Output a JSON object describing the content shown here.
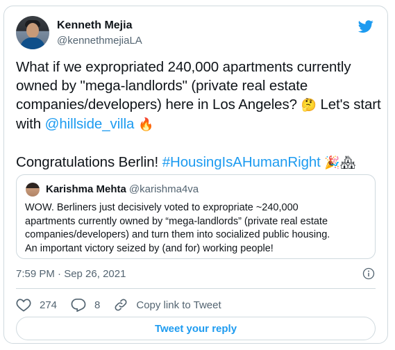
{
  "tweet": {
    "author_name": "Kenneth Mejia",
    "author_handle": "@kennethmejiaLA",
    "text": {
      "line1": "What if we expropriated 240,000 apartments currently",
      "line2": "owned by \"mega-landlords\" (private real estate",
      "line3_pre": "companies/developers) here in Los Angeles?",
      "line3_post": " Let's start",
      "line4_pre": "with ",
      "mention": "@hillside_villa",
      "line5_pre": "Congratulations Berlin! ",
      "hashtag": "#HousingIsAHumanRight"
    },
    "emojis": {
      "thinking": "🤔",
      "fire": "🔥",
      "party": "🎉",
      "houses": "🏘"
    },
    "timestamp": "7:59 PM · Sep 26, 2021",
    "stats": {
      "likes": "274",
      "replies": "8",
      "copy_link_label": "Copy link to Tweet"
    },
    "reply_button_label": "Tweet your reply"
  },
  "quoted_tweet": {
    "author_name": "Karishma Mehta",
    "author_handle": "@karishma4va",
    "lines": [
      "WOW. Berliners just decisively voted to expropriate ~240,000",
      "apartments currently owned by “mega-landlords” (private real estate",
      "companies/developers) and turn them into socialized public housing.",
      "An important victory seized by (and for) working people!"
    ]
  },
  "icons": [
    "twitter-bird-icon",
    "info-icon",
    "heart-icon",
    "reply-icon",
    "link-icon"
  ],
  "colors": {
    "accent": "#1d9bf0",
    "text": "#0f1419",
    "muted": "#536471",
    "border": "#cfd9de"
  }
}
